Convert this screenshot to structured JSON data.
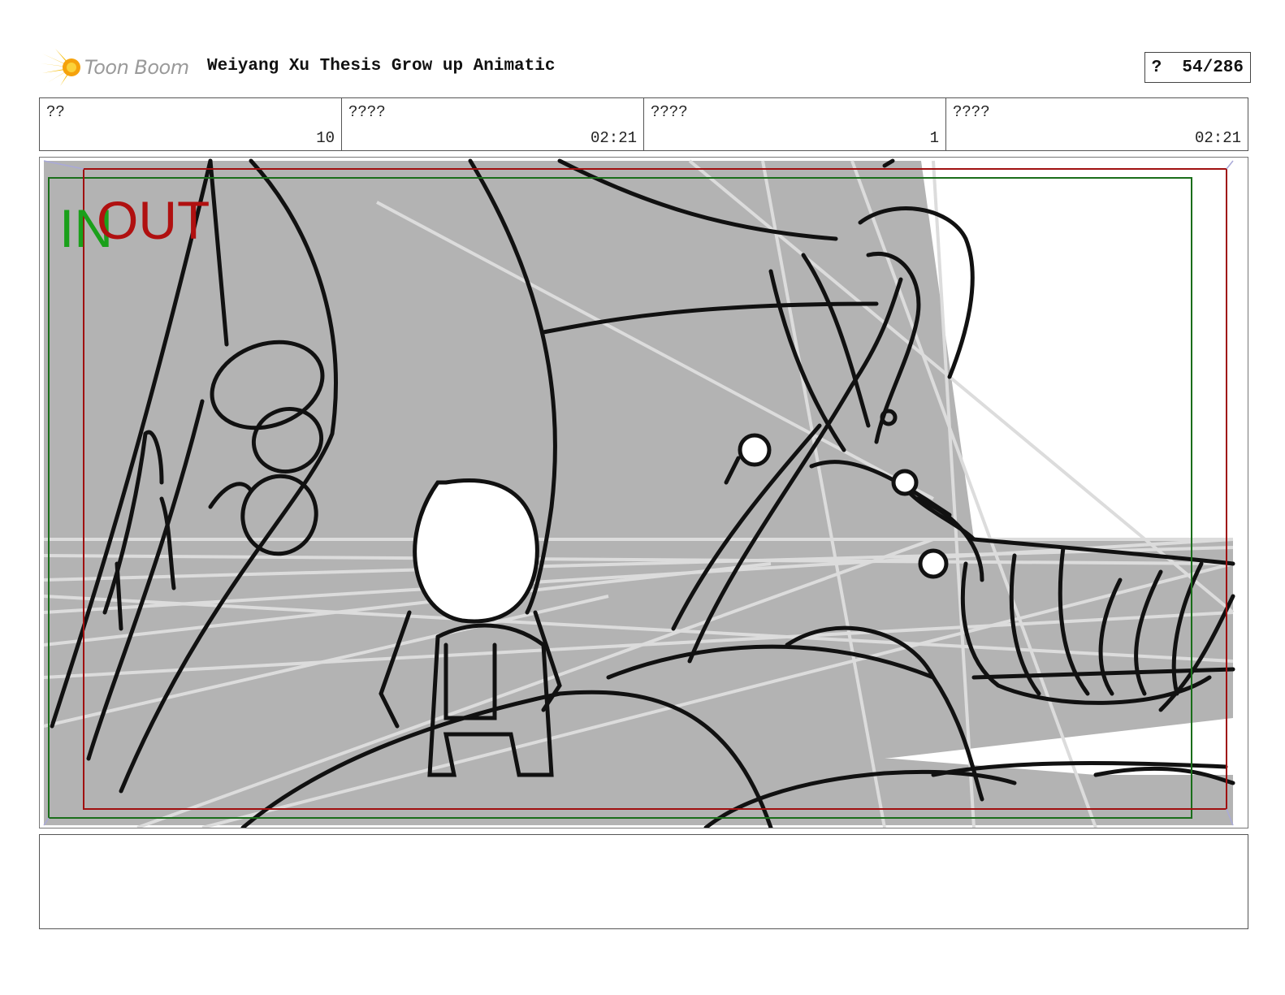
{
  "header": {
    "logo_text": "Toon Boom",
    "title": "Weiyang Xu Thesis Grow up Animatic",
    "page_indicator": "?  54/286"
  },
  "info": [
    {
      "label": "??",
      "value": "10"
    },
    {
      "label": "????",
      "value": "02:21"
    },
    {
      "label": "????",
      "value": "1"
    },
    {
      "label": "????",
      "value": "02:21"
    }
  ],
  "panel": {
    "in_marker": "IN",
    "out_marker": "OUT",
    "in_color": "#1aa01a",
    "out_color": "#b01010"
  },
  "notes": ""
}
